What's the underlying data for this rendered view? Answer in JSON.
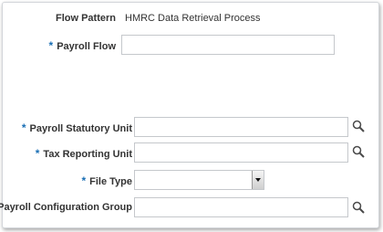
{
  "form": {
    "flow_pattern": {
      "label": "Flow Pattern",
      "value": "HMRC Data Retrieval Process"
    },
    "payroll_flow": {
      "label": "Payroll Flow",
      "required_mark": "*",
      "value": ""
    },
    "payroll_statutory_unit": {
      "label": "Payroll Statutory Unit",
      "required_mark": "*",
      "value": ""
    },
    "tax_reporting_unit": {
      "label": "Tax Reporting Unit",
      "required_mark": "*",
      "value": ""
    },
    "file_type": {
      "label": "File Type",
      "required_mark": "*",
      "selected": ""
    },
    "payroll_configuration_group": {
      "label": "Payroll Configuration Group",
      "value": ""
    }
  },
  "icons": {
    "search": "search-icon",
    "dropdown": "chevron-down-icon"
  },
  "colors": {
    "required": "#1a6fb5",
    "label": "#333333",
    "border": "#c5c8cc"
  }
}
